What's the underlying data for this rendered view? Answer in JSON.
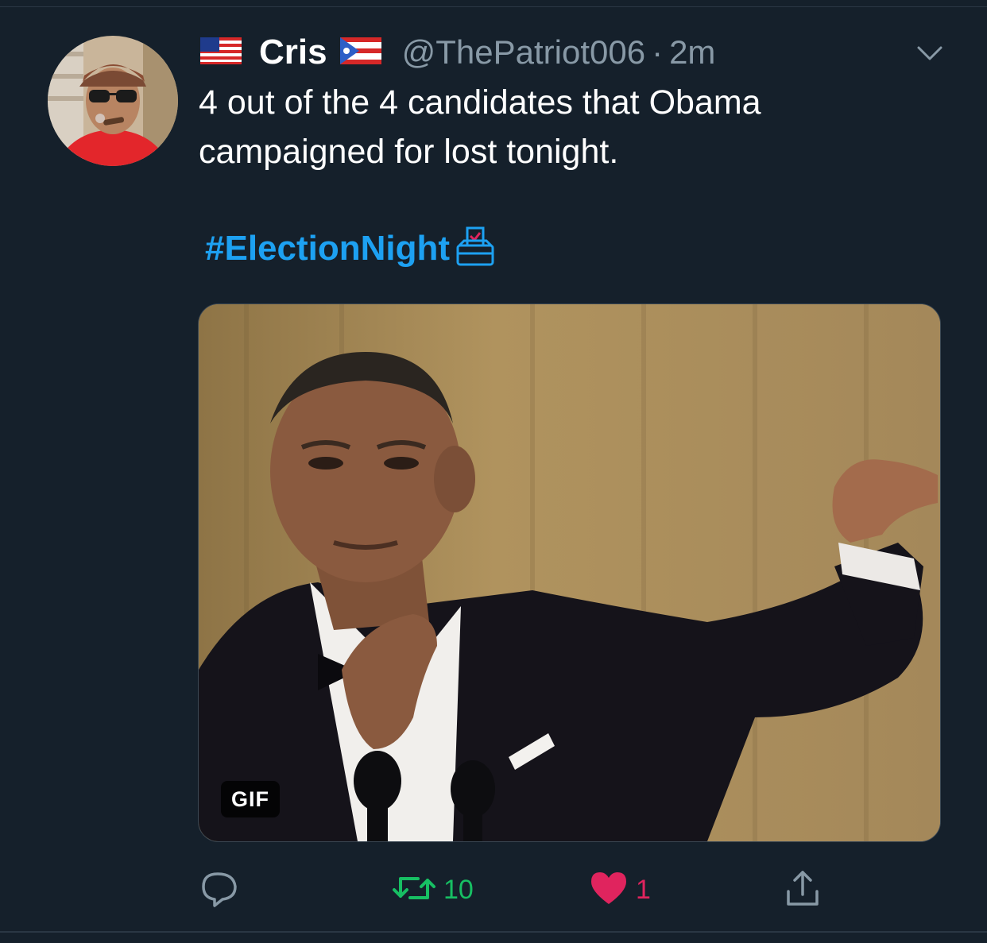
{
  "tweet": {
    "display_name": "Cris",
    "handle": "@ThePatriot006",
    "separator": "·",
    "time": "2m",
    "text": "4 out of the 4 candidates that Obama campaigned for lost tonight.",
    "hashtag": "#ElectionNight",
    "media": {
      "badge": "GIF"
    }
  },
  "actions": {
    "retweet_count": "10",
    "like_count": "1"
  },
  "colors": {
    "background": "#15202b",
    "link": "#1da1f2",
    "retweet": "#17bf63",
    "like": "#e0245e",
    "secondary_text": "#8899a6"
  },
  "icons": [
    "us-flag-icon",
    "puerto-rico-flag-icon",
    "chevron-down-icon",
    "ballot-box-icon",
    "reply-icon",
    "retweet-icon",
    "heart-icon",
    "share-icon"
  ]
}
